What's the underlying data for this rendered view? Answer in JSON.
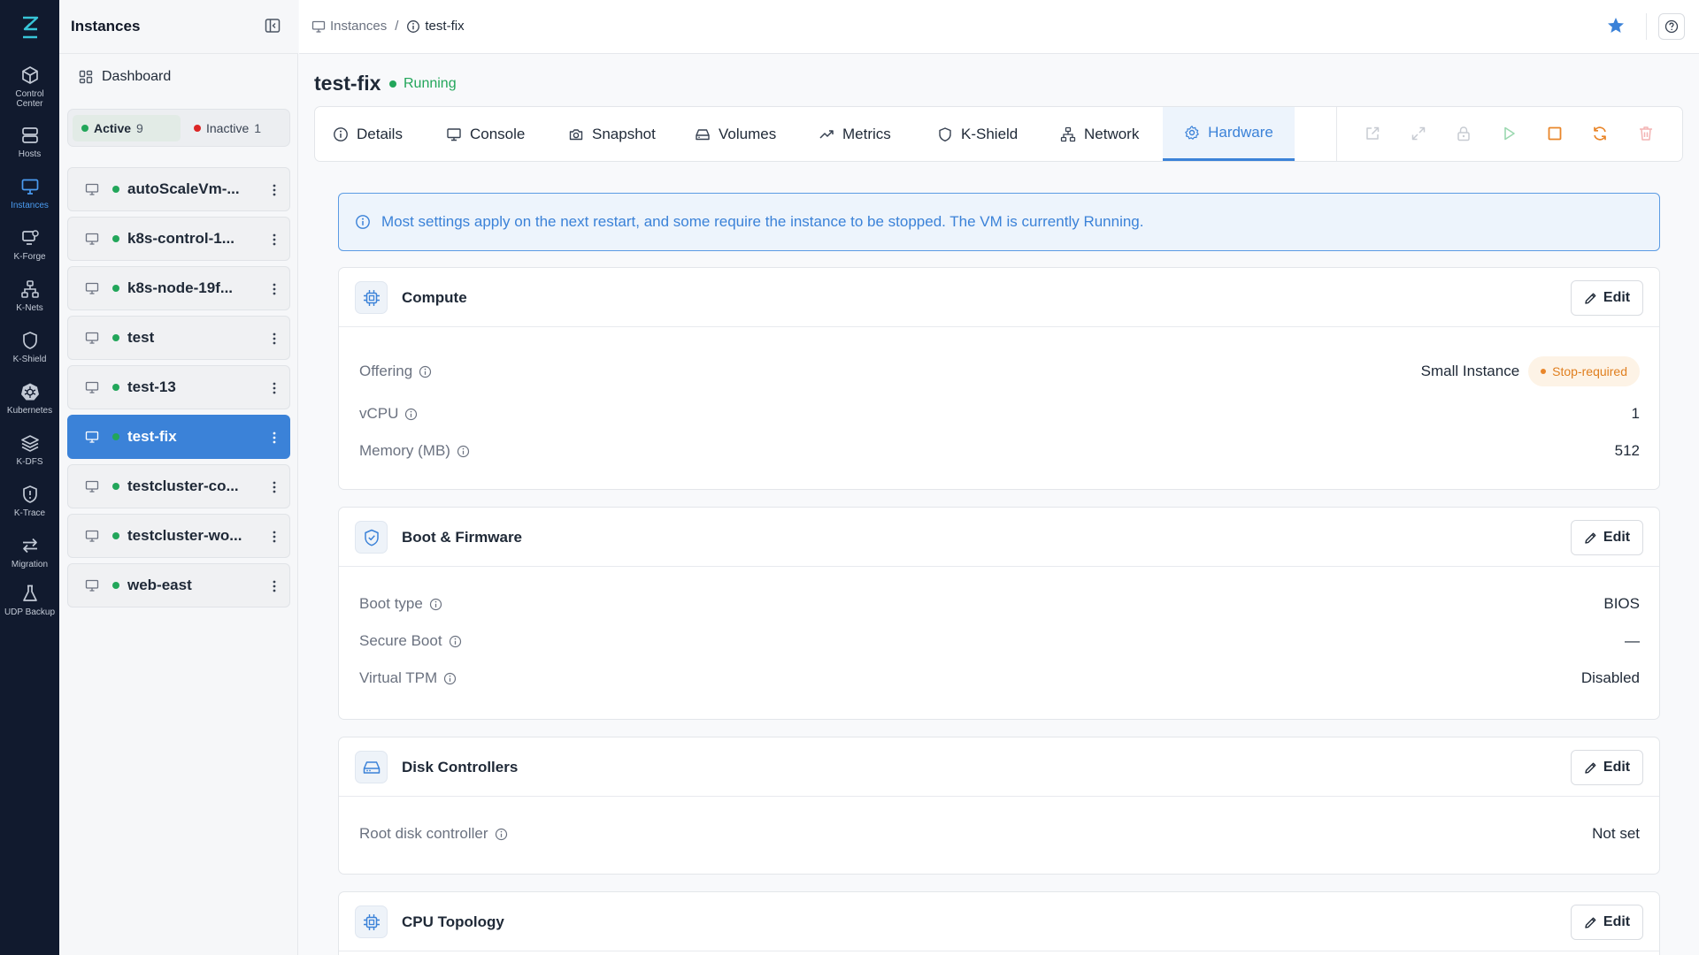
{
  "rail": {
    "items": [
      {
        "label": "Control Center",
        "icon": "cube-icon"
      },
      {
        "label": "Hosts",
        "icon": "server-icon"
      },
      {
        "label": "Instances",
        "icon": "monitor-icon"
      },
      {
        "label": "K-Forge",
        "icon": "forge-icon"
      },
      {
        "label": "K-Nets",
        "icon": "network-icon"
      },
      {
        "label": "K-Shield",
        "icon": "shield-icon"
      },
      {
        "label": "Kubernetes",
        "icon": "kubernetes-icon"
      },
      {
        "label": "K-DFS",
        "icon": "layers-icon"
      },
      {
        "label": "K-Trace",
        "icon": "trace-icon"
      },
      {
        "label": "Migration",
        "icon": "arrows-icon"
      },
      {
        "label": "UDP Backup",
        "icon": "flask-icon"
      }
    ],
    "active": "Instances"
  },
  "sidebar": {
    "title": "Instances",
    "dashboard_label": "Dashboard",
    "filters": {
      "active_label": "Active",
      "active_count": "9",
      "inactive_label": "Inactive",
      "inactive_count": "1"
    },
    "instances": [
      {
        "name": "autoScaleVm-...",
        "status": "running"
      },
      {
        "name": "k8s-control-1...",
        "status": "running"
      },
      {
        "name": "k8s-node-19f...",
        "status": "running"
      },
      {
        "name": "test",
        "status": "running"
      },
      {
        "name": "test-13",
        "status": "running"
      },
      {
        "name": "test-fix",
        "status": "running",
        "selected": true
      },
      {
        "name": "testcluster-co...",
        "status": "running"
      },
      {
        "name": "testcluster-wo...",
        "status": "running"
      },
      {
        "name": "web-east",
        "status": "running"
      }
    ]
  },
  "breadcrumb": {
    "root": "Instances",
    "separator": "/",
    "current": "test-fix"
  },
  "page": {
    "title": "test-fix",
    "status": "Running"
  },
  "tabs": [
    {
      "label": "Details",
      "icon": "info-icon"
    },
    {
      "label": "Console",
      "icon": "monitor-icon"
    },
    {
      "label": "Snapshot",
      "icon": "camera-icon"
    },
    {
      "label": "Volumes",
      "icon": "drive-icon"
    },
    {
      "label": "Metrics",
      "icon": "trend-icon"
    },
    {
      "label": "K-Shield",
      "icon": "shield-icon"
    },
    {
      "label": "Network",
      "icon": "network-icon"
    },
    {
      "label": "Hardware",
      "icon": "gear-icon"
    }
  ],
  "active_tab": "Hardware",
  "actions": [
    {
      "name": "open-external",
      "icon": "external-link-icon",
      "enabled": false
    },
    {
      "name": "expand",
      "icon": "expand-icon",
      "enabled": false
    },
    {
      "name": "lock",
      "icon": "lock-icon",
      "enabled": false
    },
    {
      "name": "start",
      "icon": "play-icon",
      "enabled": false
    },
    {
      "name": "stop",
      "icon": "stop-icon",
      "enabled": true
    },
    {
      "name": "restart",
      "icon": "refresh-icon",
      "enabled": true
    },
    {
      "name": "delete",
      "icon": "trash-icon",
      "enabled": false
    }
  ],
  "banner": {
    "text": "Most settings apply on the next restart, and some require the instance to be stopped. The VM is currently Running."
  },
  "sections": {
    "compute": {
      "title": "Compute",
      "edit_label": "Edit",
      "rows": [
        {
          "label": "Offering",
          "value": "Small Instance",
          "badge": "Stop-required"
        },
        {
          "label": "vCPU",
          "value": "1"
        },
        {
          "label": "Memory (MB)",
          "value": "512"
        }
      ]
    },
    "boot": {
      "title": "Boot & Firmware",
      "edit_label": "Edit",
      "rows": [
        {
          "label": "Boot type",
          "value": "BIOS"
        },
        {
          "label": "Secure Boot",
          "value": "—"
        },
        {
          "label": "Virtual TPM",
          "value": "Disabled"
        }
      ]
    },
    "disk": {
      "title": "Disk Controllers",
      "edit_label": "Edit",
      "rows": [
        {
          "label": "Root disk controller",
          "value": "Not set"
        }
      ]
    },
    "cpu_topology": {
      "title": "CPU Topology",
      "edit_label": "Edit"
    }
  },
  "colors": {
    "accent": "#3b82d8",
    "rail_bg": "#111a2e",
    "running": "#22a65a",
    "inactive": "#dc2626",
    "warning": "#e07f1f"
  }
}
